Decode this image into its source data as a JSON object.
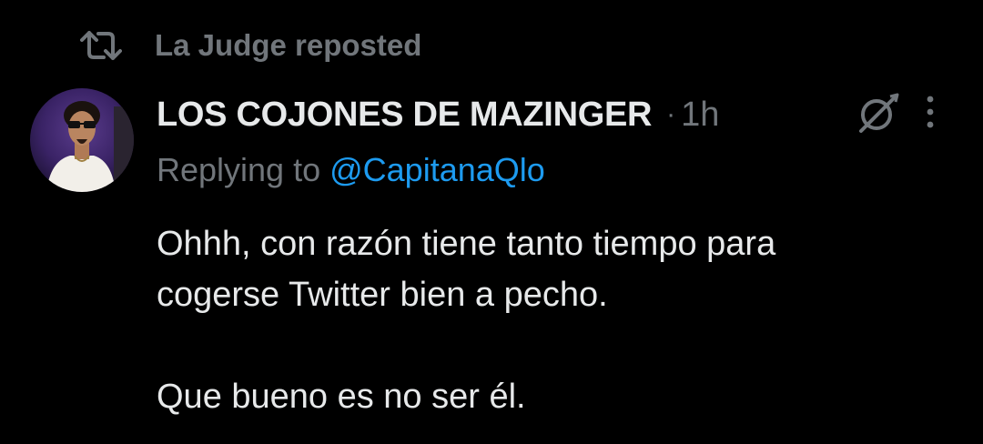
{
  "colors": {
    "background": "#000000",
    "primary_text": "#e7e9ea",
    "secondary_text": "#71767b",
    "link": "#1d9bf0"
  },
  "repost": {
    "icon": "repost-icon",
    "text": "La Judge reposted"
  },
  "tweet": {
    "avatar_icon": "avatar",
    "display_name": "LOS COJONES DE MAZINGER",
    "separator": "·",
    "timestamp": "1h",
    "grok_icon": "grok-icon",
    "more_icon": "more-icon",
    "reply_prefix": "Replying to",
    "reply_handle": "@CapitanaQlo",
    "body_lines": [
      "Ohhh, con razón tiene tanto tiempo para",
      "cogerse Twitter bien a pecho.",
      "Que bueno es no ser él."
    ]
  }
}
